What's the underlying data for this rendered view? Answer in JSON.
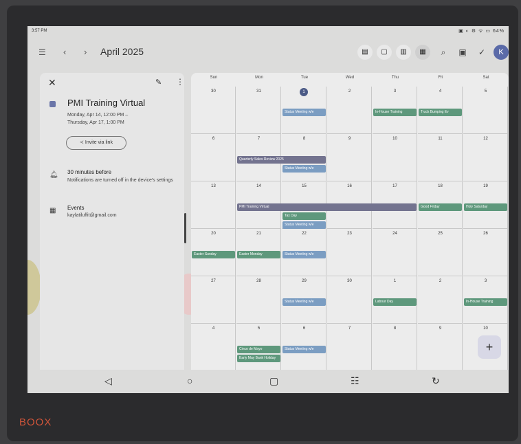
{
  "status": {
    "time": "3:57 PM",
    "icons": "▣ ◐ ⚙ ᯤ ▭ 64%"
  },
  "topbar": {
    "month": "April 2025",
    "views": [
      {
        "label": "▤",
        "name": "agenda-view-icon"
      },
      {
        "label": "▢",
        "name": "day-view-icon"
      },
      {
        "label": "▥",
        "name": "week-view-icon"
      },
      {
        "label": "▦",
        "name": "month-view-icon"
      }
    ],
    "avatar": "K"
  },
  "event": {
    "title": "PMI Training Virtual",
    "date_line1": "Monday, Apr 14, 12:00 PM –",
    "date_line2": "Thursday, Apr 17, 1:00 PM",
    "invite": "Invite via link",
    "reminder": "30 minutes before",
    "reminder_note": "Notifications are turned off in the device's settings",
    "calendar": "Events",
    "email": "kaylatiluffit@gmail.com"
  },
  "weekdays": [
    "Sun",
    "Mon",
    "Tue",
    "Wed",
    "Thu",
    "Fri",
    "Sat"
  ],
  "weeks": [
    [
      "30",
      "31",
      "1",
      "2",
      "3",
      "4",
      "5"
    ],
    [
      "6",
      "7",
      "8",
      "9",
      "10",
      "11",
      "12"
    ],
    [
      "13",
      "14",
      "15",
      "16",
      "17",
      "18",
      "19"
    ],
    [
      "20",
      "21",
      "22",
      "23",
      "24",
      "25",
      "26"
    ],
    [
      "27",
      "28",
      "29",
      "30",
      "1",
      "2",
      "3"
    ],
    [
      "4",
      "5",
      "6",
      "7",
      "8",
      "9",
      "10"
    ]
  ],
  "events": [
    {
      "label": "Status Meeting w/e",
      "color": "blue"
    },
    {
      "label": "In-House Training",
      "color": "green"
    },
    {
      "label": "Truck Bumping Ev",
      "color": "green"
    },
    {
      "label": "Quarterly Sales Review 2025",
      "color": "slate"
    },
    {
      "label": "Status Meeting w/e",
      "color": "blue"
    },
    {
      "label": "PMI Training Virtual",
      "color": "slate"
    },
    {
      "label": "Tax Day",
      "color": "green"
    },
    {
      "label": "Status Meeting w/e",
      "color": "blue"
    },
    {
      "label": "Good Friday",
      "color": "green"
    },
    {
      "label": "Holy Saturday",
      "color": "green"
    },
    {
      "label": "Easter Sunday",
      "color": "green"
    },
    {
      "label": "Easter Monday",
      "color": "green"
    },
    {
      "label": "Status Meeting w/e",
      "color": "blue"
    },
    {
      "label": "Status Meeting w/e",
      "color": "blue"
    },
    {
      "label": "Labour Day",
      "color": "green"
    },
    {
      "label": "In-House Training",
      "color": "green"
    },
    {
      "label": "Cinco de Mayo",
      "color": "green"
    },
    {
      "label": "Early May Bank Holiday",
      "color": "green"
    },
    {
      "label": "Status Meeting w/e",
      "color": "blue"
    }
  ],
  "fab": "+",
  "brand": "BOOX"
}
